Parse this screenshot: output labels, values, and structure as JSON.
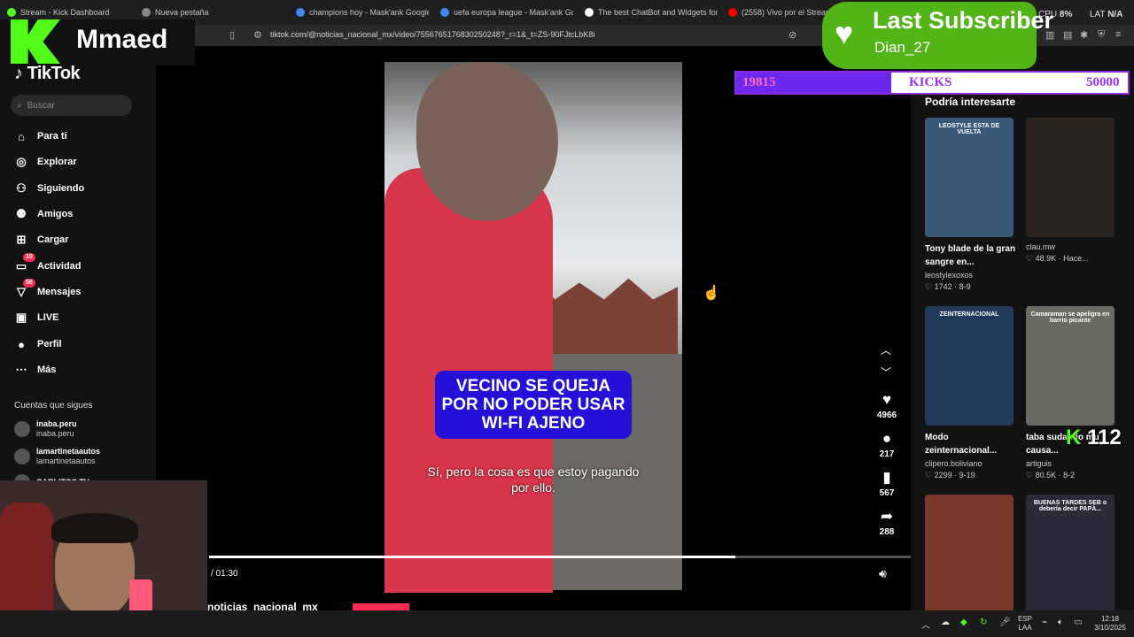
{
  "browser": {
    "tabs": [
      {
        "label": "Stream - Kick Dashboard",
        "color": "#53fc18"
      },
      {
        "label": "Nueva pestaña",
        "color": "#888888"
      },
      {
        "label": "champions hoy - Mask'ank Google",
        "color": "#4285f4"
      },
      {
        "label": "uefa europa league - Mask'ank Goog",
        "color": "#4285f4"
      },
      {
        "label": "The best ChatBot and Widgets for Ki",
        "color": "#ffffff"
      },
      {
        "label": "(2558) Vivo por el Streaming",
        "color": "#ff0000"
      }
    ],
    "url": "tiktok.com/@noticias_nacional_mx/video/7556765176830250248?_r=1&_t=ZS-90FJtcLbK8i",
    "cpu_label": "CPU",
    "cpu_value": "8%",
    "lat_label": "LAT",
    "lat_value": "N/A"
  },
  "tiktok": {
    "logo": "TikTok",
    "search_placeholder": "Buscar",
    "nav": [
      {
        "label": "Para ti",
        "icon": "home-icon",
        "glyph": "⌂"
      },
      {
        "label": "Explorar",
        "icon": "compass-icon",
        "glyph": "◎"
      },
      {
        "label": "Siguiendo",
        "icon": "following-icon",
        "glyph": "⚇"
      },
      {
        "label": "Amigos",
        "icon": "friends-icon",
        "glyph": "⚉"
      },
      {
        "label": "Cargar",
        "icon": "upload-icon",
        "glyph": "⊞"
      },
      {
        "label": "Actividad",
        "icon": "activity-icon",
        "glyph": "▭",
        "badge": "10"
      },
      {
        "label": "Mensajes",
        "icon": "messages-icon",
        "glyph": "▽",
        "badge": "56"
      },
      {
        "label": "LIVE",
        "icon": "live-icon",
        "glyph": "▣"
      },
      {
        "label": "Perfil",
        "icon": "profile-icon",
        "glyph": "●"
      },
      {
        "label": "Más",
        "icon": "more-icon",
        "glyph": "⋯"
      }
    ],
    "following_header": "Cuentas que sigues",
    "accounts": [
      {
        "name": "inaba.peru",
        "handle": "inaba.peru"
      },
      {
        "name": "lamartinetaautos",
        "handle": "lamartinetaautos"
      },
      {
        "name": "CARLITOS TV",
        "handle": ""
      }
    ]
  },
  "video": {
    "caption": "VECINO SE QUEJA POR NO PODER USAR WI-FI AJENO",
    "subtitle": "Sí, pero la cosa es que estoy pagando por ello.",
    "time": "/ 01:30",
    "progress": 0.75,
    "author": "noticias_nacional_mx",
    "likes": "4966",
    "comments": "217",
    "saves": "567",
    "shares": "288"
  },
  "recommendations": {
    "title": "Podría interesarte",
    "items": [
      {
        "title": "Tony blade de la gran sangre en...",
        "author": "leostylexoxos",
        "likes": "1742",
        "date": "8-9",
        "thumb_color": "#3a5a7a",
        "thumb_text": "LEOSTYLE ESTA DE VUELTA"
      },
      {
        "title": "",
        "author": "clau.mw",
        "likes": "48.9K",
        "date": "Hace...",
        "thumb_color": "#2a2420",
        "thumb_text": ""
      },
      {
        "title": "Modo zeinternacional...",
        "author": "clipero.boliviano",
        "likes": "2299",
        "date": "9-19",
        "thumb_color": "#1f3a5a",
        "thumb_text": "ZEINTERNACIONAL"
      },
      {
        "title": "taba sudando mu causa...",
        "author": "artiguis",
        "likes": "80.5K",
        "date": "8-2",
        "thumb_color": "#6a6a62",
        "thumb_text": "Camaraman se apeligra en barrio picante"
      },
      {
        "title": "",
        "author": "",
        "likes": "",
        "date": "",
        "thumb_color": "#7a3a2a",
        "thumb_text": ""
      },
      {
        "title": "",
        "author": "",
        "likes": "",
        "date": "",
        "thumb_color": "#2a2a3a",
        "thumb_text": "BUENAS TARDES SEB o debería decir PAPÁ..."
      }
    ]
  },
  "overlay": {
    "channel": "Mmaed",
    "sub_title": "Last Subscriber",
    "sub_name": "Dian_27",
    "goal_current": "19815",
    "goal_label": "KICKS",
    "goal_max": "50000",
    "goal_progress": 0.396,
    "kick_counter": "112"
  },
  "taskbar": {
    "lang1": "ESP",
    "lang2": "LAA",
    "time": "12:18",
    "date": "3/10/2025"
  }
}
